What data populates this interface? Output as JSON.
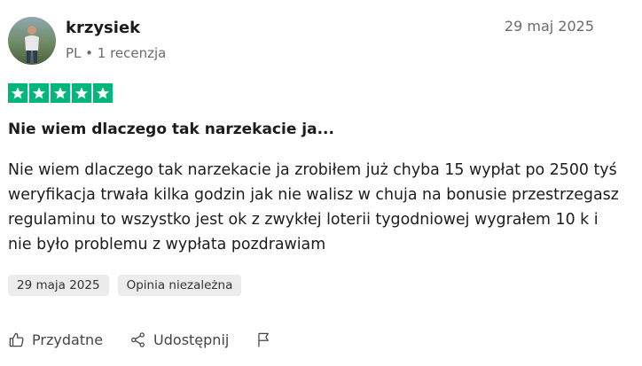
{
  "reviewer": {
    "name": "krzysiek",
    "meta": "PL • 1 recenzja"
  },
  "review": {
    "date_top": "29 maj 2025",
    "rating": 5,
    "rating_color": "#00b67a",
    "title": "Nie wiem dlaczego tak narzekacie ja...",
    "body": "Nie wiem dlaczego tak narzekacie ja zrobiłem już chyba 15 wypłat po 2500 tyś weryfikacja trwała kilka godzin jak nie walisz w chuja na bonusie przestrzegasz regulaminu to wszystko jest ok z zwykłej loterii tygodniowej wygrałem 10 k i nie było problemu z wypłata pozdrawiam",
    "tags": [
      "29 maja 2025",
      "Opinia niezależna"
    ]
  },
  "actions": {
    "helpful_label": "Przydatne",
    "share_label": "Udostępnij",
    "helpful_icon": "thumbs-up-icon",
    "share_icon": "share-icon",
    "report_icon": "flag-icon"
  }
}
